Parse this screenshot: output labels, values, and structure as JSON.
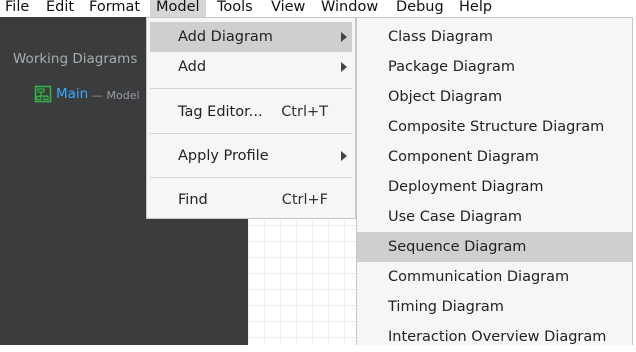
{
  "menubar": {
    "items": [
      "File",
      "Edit",
      "Format",
      "Model",
      "Tools",
      "View",
      "Window",
      "Debug",
      "Help"
    ],
    "active": "Model"
  },
  "sidebar": {
    "title": "Working Diagrams",
    "item": {
      "icon": "class-diagram-icon",
      "name": "Main",
      "type": "— Model"
    }
  },
  "model_menu": {
    "items": [
      {
        "label": "Add Diagram",
        "submenu": true,
        "highlighted": true
      },
      {
        "label": "Add",
        "submenu": true
      },
      {
        "label": "Tag Editor...",
        "shortcut": "Ctrl+T"
      },
      {
        "label": "Apply Profile",
        "submenu": true
      },
      {
        "label": "Find",
        "shortcut": "Ctrl+F"
      }
    ]
  },
  "submenu": {
    "items": [
      "Class Diagram",
      "Package Diagram",
      "Object Diagram",
      "Composite Structure Diagram",
      "Component Diagram",
      "Deployment Diagram",
      "Use Case Diagram",
      "Sequence Diagram",
      "Communication Diagram",
      "Timing Diagram",
      "Interaction Overview Diagram"
    ],
    "highlighted": "Sequence Diagram"
  },
  "colors": {
    "sidebar_bg": "#3a3c3d",
    "link_blue": "#39a9ff",
    "icon_green": "#35b24a",
    "highlight": "#cfcfcf"
  }
}
